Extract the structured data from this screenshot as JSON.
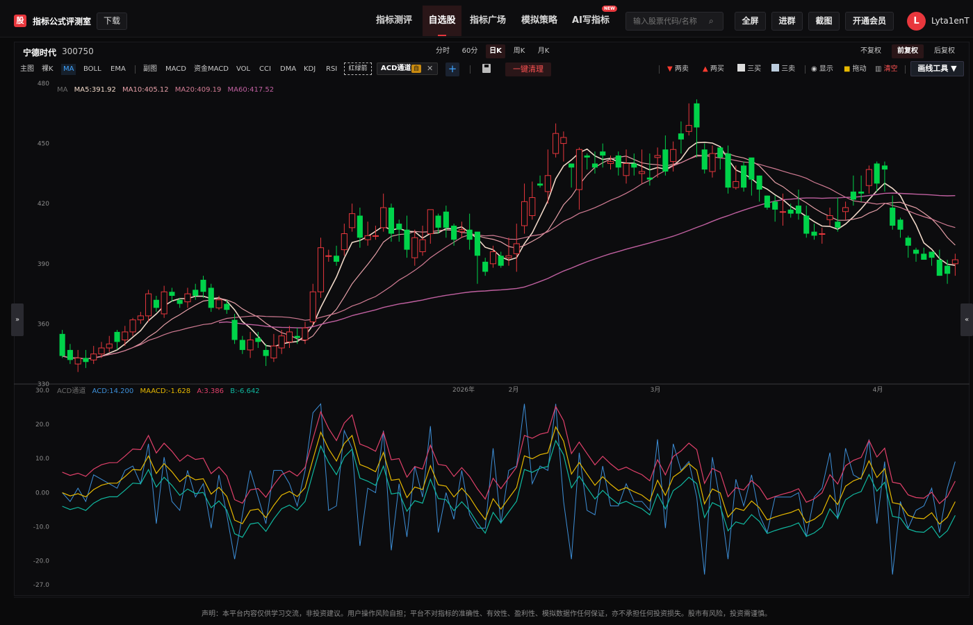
{
  "app": {
    "title": "指标公式评测室",
    "logo": "股",
    "download": "下载"
  },
  "nav": [
    {
      "label": "指标测评",
      "active": false
    },
    {
      "label": "自选股",
      "active": true
    },
    {
      "label": "指标广场",
      "active": false
    },
    {
      "label": "模拟策略",
      "active": false
    },
    {
      "label": "AI写指标",
      "active": false,
      "badge": "NEW"
    }
  ],
  "search": {
    "placeholder": "输入股票代码/名称"
  },
  "top_buttons": [
    "全屏",
    "进群",
    "截图",
    "开通会员"
  ],
  "user": {
    "initial": "L",
    "name": "Lyta1enT"
  },
  "stock": {
    "name": "宁德时代",
    "code": "300750"
  },
  "periods": [
    {
      "label": "分时",
      "active": false
    },
    {
      "label": "60分",
      "active": false
    },
    {
      "label": "日K",
      "active": true
    },
    {
      "label": "周K",
      "active": false
    },
    {
      "label": "月K",
      "active": false
    }
  ],
  "fuquan": [
    {
      "label": "不复权",
      "active": false
    },
    {
      "label": "前复权",
      "active": true
    },
    {
      "label": "后复权",
      "active": false
    }
  ],
  "toolbar": {
    "main_label": "主图",
    "main_items": [
      {
        "label": "裸K",
        "active": false
      },
      {
        "label": "MA",
        "active": true
      },
      {
        "label": "BOLL",
        "active": false
      },
      {
        "label": "EMA",
        "active": false
      }
    ],
    "sub_label": "副图",
    "sub_items": [
      "MACD",
      "资金MACD",
      "VOL",
      "CCI",
      "DMA",
      "KDJ",
      "RSI"
    ],
    "red_green": "红绿箭",
    "acd_chip": "ACD通道",
    "acd_tag": "自",
    "clear": "一键清理",
    "right_tools": [
      {
        "label": "两卖",
        "icon": "down-triangle-icon",
        "color": "#ff3b30"
      },
      {
        "label": "两买",
        "icon": "up-triangle-icon",
        "color": "#ff3b30"
      },
      {
        "label": "三买",
        "icon": "trend-line-icon",
        "color": "#ff3b30"
      },
      {
        "label": "三卖",
        "icon": "ray-line-icon",
        "color": "#4a90e2"
      },
      {
        "label": "显示",
        "icon": "eye-icon",
        "color": "#ffffff"
      },
      {
        "label": "拖动",
        "icon": "lock-icon",
        "color": "#e6b800"
      },
      {
        "label": "清空",
        "icon": "trash-icon",
        "color": "#ff5252"
      }
    ],
    "draw_tools": "画线工具 ▼"
  },
  "main_chart": {
    "ma_legend": [
      {
        "label": "MA",
        "color": "#6b6b6b"
      },
      {
        "label": "MA5:391.92",
        "color": "#f0d8c8"
      },
      {
        "label": "MA10:405.12",
        "color": "#e6a0a8"
      },
      {
        "label": "MA20:409.19",
        "color": "#d27c94"
      },
      {
        "label": "MA60:417.52",
        "color": "#c060a0"
      }
    ],
    "y_ticks": [
      "480",
      "450",
      "420",
      "390",
      "360",
      "330"
    ],
    "x_labels": [
      "2026年",
      "2月",
      "3月",
      "4月"
    ],
    "up_color": "#e8373d",
    "down_color": "#00d34a"
  },
  "sub_chart": {
    "legend": [
      {
        "label": "ACD通道",
        "color": "#6b6b6b"
      },
      {
        "label": "ACD:14.200",
        "color": "#3d8fd8"
      },
      {
        "label": "MAACD:-1.628",
        "color": "#e6b800"
      },
      {
        "label": "A:3.386",
        "color": "#e0406a"
      },
      {
        "label": "B:-6.642",
        "color": "#10b8a0"
      }
    ],
    "y_ticks": [
      "30.0",
      "20.0",
      "10.0",
      "0.00",
      "-10.0",
      "-20.0",
      "-27.0"
    ]
  },
  "chart_data": {
    "type": "candlestick",
    "ylim": [
      330,
      480
    ],
    "candles": [
      [
        355,
        344,
        357,
        343
      ],
      [
        347,
        342,
        350,
        340
      ],
      [
        340,
        343,
        347,
        336
      ],
      [
        343,
        341,
        347,
        338
      ],
      [
        342,
        345,
        349,
        340
      ],
      [
        345,
        348,
        351,
        343
      ],
      [
        348,
        350,
        354,
        346
      ],
      [
        356,
        351,
        357,
        347
      ],
      [
        352,
        356,
        359,
        349
      ],
      [
        356,
        362,
        363,
        354
      ],
      [
        362,
        364,
        366,
        360
      ],
      [
        364,
        375,
        377,
        361
      ],
      [
        372,
        368,
        374,
        366
      ],
      [
        365,
        376,
        379,
        363
      ],
      [
        376,
        374,
        378,
        371
      ],
      [
        372,
        370,
        373,
        368
      ],
      [
        371,
        375,
        378,
        368
      ],
      [
        377,
        374,
        380,
        372
      ],
      [
        382,
        376,
        384,
        373
      ],
      [
        378,
        368,
        380,
        366
      ],
      [
        368,
        372,
        374,
        367
      ],
      [
        370,
        367,
        372,
        365
      ],
      [
        362,
        352,
        365,
        350
      ],
      [
        352,
        347,
        354,
        345
      ],
      [
        347,
        352,
        356,
        343
      ],
      [
        353,
        351,
        356,
        348
      ],
      [
        347,
        344,
        350,
        339
      ],
      [
        343,
        349,
        355,
        341
      ],
      [
        348,
        354,
        357,
        345
      ],
      [
        351,
        356,
        359,
        348
      ],
      [
        354,
        353,
        358,
        350
      ],
      [
        352,
        358,
        361,
        350
      ],
      [
        361,
        376,
        380,
        359
      ],
      [
        376,
        398,
        403,
        373
      ],
      [
        394,
        394,
        397,
        391
      ],
      [
        394,
        391,
        399,
        389
      ],
      [
        397,
        405,
        410,
        394
      ],
      [
        408,
        415,
        420,
        406
      ],
      [
        414,
        403,
        418,
        398
      ],
      [
        402,
        404,
        411,
        399
      ],
      [
        404,
        404,
        409,
        402
      ],
      [
        408,
        418,
        425,
        406
      ],
      [
        418,
        405,
        420,
        401
      ],
      [
        410,
        407,
        412,
        401
      ],
      [
        407,
        397,
        414,
        393
      ],
      [
        393,
        403,
        407,
        389
      ],
      [
        396,
        402,
        409,
        394
      ],
      [
        405,
        417,
        417,
        400
      ],
      [
        414,
        408,
        415,
        405
      ],
      [
        416,
        408,
        419,
        403
      ],
      [
        409,
        402,
        410,
        399
      ],
      [
        406,
        407,
        411,
        403
      ],
      [
        407,
        402,
        415,
        397
      ],
      [
        406,
        394,
        406,
        380
      ],
      [
        391,
        386,
        393,
        384
      ],
      [
        390,
        396,
        399,
        388
      ],
      [
        394,
        389,
        396,
        388
      ],
      [
        393,
        394,
        403,
        389
      ],
      [
        395,
        400,
        410,
        386
      ],
      [
        409,
        421,
        430,
        405
      ],
      [
        414,
        423,
        431,
        412
      ],
      [
        430,
        429,
        434,
        428
      ],
      [
        426,
        434,
        447,
        420
      ],
      [
        445,
        455,
        460,
        443
      ],
      [
        450,
        453,
        456,
        441
      ],
      [
        440,
        438,
        440,
        428
      ],
      [
        427,
        447,
        448,
        417
      ],
      [
        444,
        443,
        445,
        437
      ],
      [
        440,
        438,
        446,
        435
      ],
      [
        446,
        444,
        450,
        438
      ],
      [
        440,
        441,
        444,
        437
      ],
      [
        444,
        438,
        446,
        434
      ],
      [
        434,
        440,
        447,
        430
      ],
      [
        440,
        438,
        445,
        434
      ],
      [
        435,
        436,
        447,
        430
      ],
      [
        433,
        432,
        445,
        429
      ],
      [
        443,
        444,
        448,
        433
      ],
      [
        447,
        436,
        454,
        434
      ],
      [
        441,
        447,
        451,
        436
      ],
      [
        455,
        452,
        461,
        445
      ],
      [
        456,
        459,
        470,
        454
      ],
      [
        470,
        458,
        472,
        443
      ],
      [
        447,
        437,
        450,
        435
      ],
      [
        436,
        445,
        449,
        433
      ],
      [
        448,
        443,
        447,
        437
      ],
      [
        445,
        428,
        449,
        425
      ],
      [
        428,
        431,
        439,
        427
      ],
      [
        439,
        428,
        441,
        426
      ],
      [
        443,
        432,
        440,
        424
      ],
      [
        434,
        427,
        434,
        421
      ],
      [
        424,
        418,
        424,
        417
      ],
      [
        421,
        417,
        424,
        411
      ],
      [
        416,
        416,
        425,
        409
      ],
      [
        417,
        415,
        420,
        413
      ],
      [
        419,
        415,
        427,
        412
      ],
      [
        414,
        405,
        419,
        403
      ],
      [
        406,
        404,
        410,
        402
      ],
      [
        405,
        405,
        408,
        400
      ],
      [
        412,
        414,
        418,
        409
      ],
      [
        411,
        408,
        423,
        406
      ],
      [
        416,
        418,
        421,
        412
      ],
      [
        426,
        422,
        434,
        419
      ],
      [
        426,
        425,
        434,
        421
      ],
      [
        429,
        437,
        439,
        425
      ],
      [
        440,
        430,
        441,
        426
      ],
      [
        439,
        437,
        441,
        426
      ],
      [
        418,
        409,
        424,
        407
      ],
      [
        412,
        407,
        413,
        403
      ],
      [
        403,
        399,
        404,
        393
      ],
      [
        397,
        395,
        398,
        391
      ],
      [
        395,
        392,
        398,
        392
      ],
      [
        396,
        393,
        396,
        389
      ],
      [
        392,
        384,
        397,
        384
      ],
      [
        389,
        385,
        392,
        380
      ],
      [
        390,
        392,
        395,
        384
      ]
    ],
    "sub_series": [
      {
        "name": "ACD"
      },
      {
        "name": "MAACD"
      },
      {
        "name": "A"
      },
      {
        "name": "B"
      }
    ]
  },
  "disclaimer": "声明：本平台内容仅供学习交流，非投资建议。用户操作风险自担；平台不对指标的准确性、有效性、盈利性、模拟数据作任何保证，亦不承担任何投资损失。股市有风险，投资需谨慎。"
}
